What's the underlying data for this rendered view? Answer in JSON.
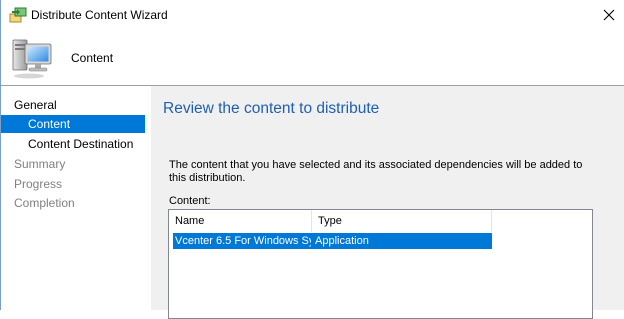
{
  "window": {
    "title": "Distribute Content Wizard",
    "close_glyph": "✕"
  },
  "header": {
    "title": "Content",
    "icon": "computer-icon"
  },
  "nav": {
    "items": [
      {
        "label": "General",
        "state": "normal"
      },
      {
        "label": "Content",
        "state": "selected"
      },
      {
        "label": "Content Destination",
        "state": "normal"
      },
      {
        "label": "Summary",
        "state": "disabled"
      },
      {
        "label": "Progress",
        "state": "disabled"
      },
      {
        "label": "Completion",
        "state": "disabled"
      }
    ]
  },
  "main": {
    "title": "Review the content to distribute",
    "description": "The content that you have selected and its associated dependencies will be added to this distribution.",
    "content_label": "Content:",
    "table": {
      "columns": [
        "Name",
        "Type"
      ],
      "rows": [
        {
          "name": "Vcenter 6.5 For Windows Sys...",
          "type": "Application",
          "selected": true
        }
      ]
    }
  },
  "colors": {
    "selection": "#0078d7",
    "heading": "#1f5fb0",
    "panel_bg": "#f0f0f0",
    "disabled_text": "#808080"
  }
}
